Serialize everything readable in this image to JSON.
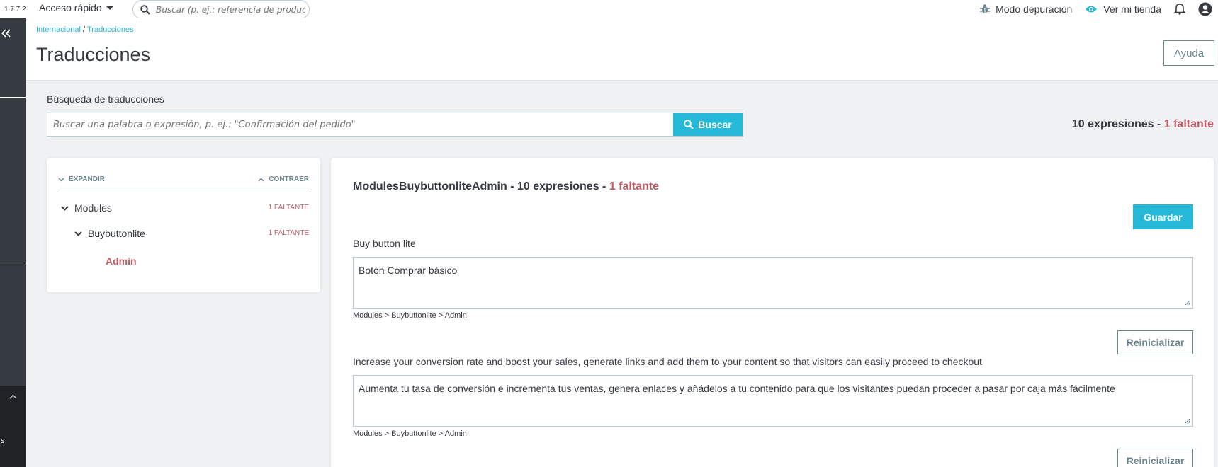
{
  "topbar": {
    "version": "1.7.7.2",
    "quick_access": "Acceso rápido",
    "search_placeholder": "Buscar (p. ej.: referencia de producto, nom",
    "debug_mode": "Modo depuración",
    "view_store": "Ver mi tienda"
  },
  "sidebar": {
    "collapsed_letter": "s"
  },
  "header": {
    "breadcrumb": [
      "Internacional",
      "Traducciones"
    ],
    "breadcrumb_sep": " / ",
    "title": "Traducciones",
    "help_label": "Ayuda"
  },
  "search": {
    "label": "Búsqueda de traducciones",
    "placeholder": "Buscar una palabra o expresión, p. ej.: \"Confirmación del pedido\"",
    "button_label": "Buscar",
    "summary_count": "10 expresiones - ",
    "summary_missing": "1 faltante"
  },
  "tree": {
    "expand_label": "EXPANDIR",
    "collapse_label": "CONTRAER",
    "nodes": [
      {
        "label": "Modules",
        "count": "1 FALTANTE"
      },
      {
        "label": "Buybuttonlite",
        "count": "1 FALTANTE"
      }
    ],
    "selected": "Admin"
  },
  "translations": {
    "title_prefix": "ModulesBuybuttonliteAdmin - 10 expresiones - ",
    "title_missing": "1 faltante",
    "save_label": "Guardar",
    "reset_label": "Reinicializar",
    "items": [
      {
        "source": "Buy button lite",
        "value": "Botón Comprar básico",
        "path": "Modules > Buybuttonlite > Admin"
      },
      {
        "source": "Increase your conversion rate and boost your sales, generate links and add them to your content so that visitors can easily proceed to checkout",
        "value": "Aumenta tu tasa de conversión e incrementa tus ventas, genera enlaces y añádelos a tu contenido para que los visitantes puedan proceder a pasar por caja más fácilmente",
        "path": "Modules > Buybuttonlite > Admin"
      }
    ]
  },
  "colors": {
    "primary": "#25b9d7",
    "missing": "#c05c67",
    "sidebar": "#363a41",
    "text": "#363a41",
    "muted": "#6c868e"
  },
  "icons": [
    "search-icon",
    "bug-icon",
    "eye-icon",
    "bell-icon",
    "user-icon",
    "double-chevron-left-icon",
    "chevron-down-icon",
    "chevron-up-icon",
    "resize-grip-icon"
  ]
}
